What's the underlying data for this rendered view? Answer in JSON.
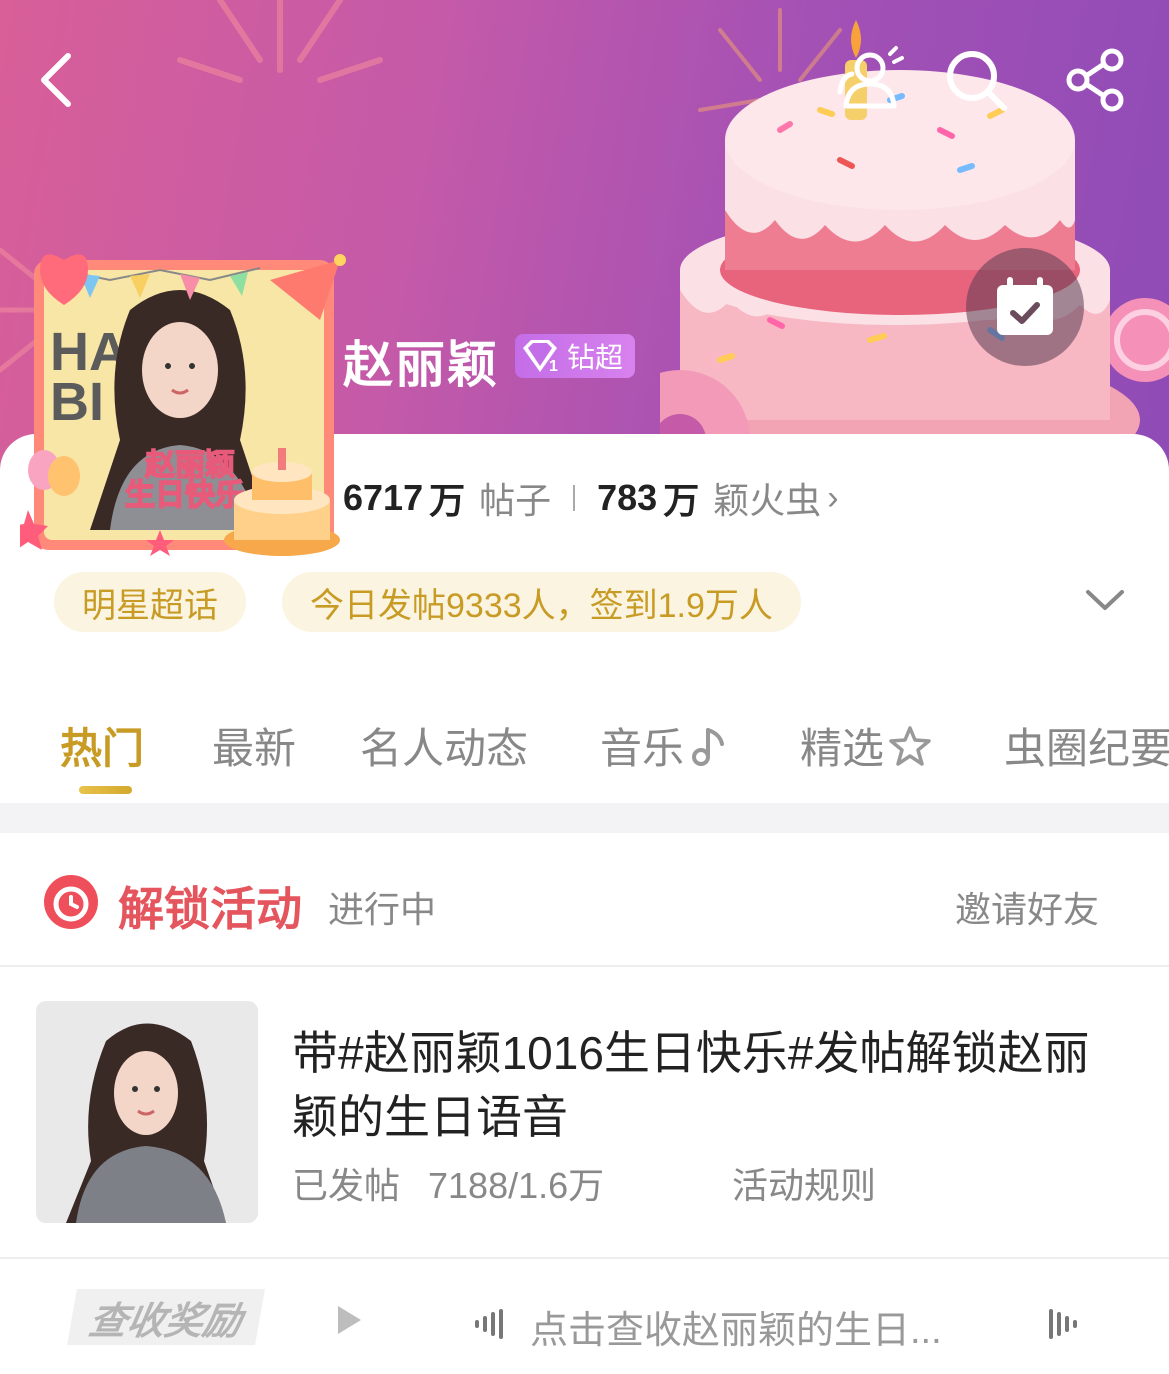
{
  "header": {
    "title": "赵丽颖",
    "badge_label": "钻超",
    "badge_level": "1",
    "avatar_text": "赵丽颖\n生日快乐",
    "avatar_line1": "赵丽颖",
    "avatar_line2": "生日快乐",
    "avatar_bg_text1": "HA",
    "avatar_bg_text2": "BI"
  },
  "stats": {
    "posts_value": "6717",
    "posts_unit": "万",
    "posts_label": "帖子",
    "fans_value": "783",
    "fans_unit": "万",
    "fans_label": "颖火虫"
  },
  "pills": {
    "category": "明星超话",
    "today": "今日发帖9333人，签到1.9万人"
  },
  "tabs": [
    {
      "label": "热门"
    },
    {
      "label": "最新"
    },
    {
      "label": "名人动态"
    },
    {
      "label": "音乐"
    },
    {
      "label": "精选"
    },
    {
      "label": "虫圈纪要"
    }
  ],
  "activity": {
    "title": "解锁活动",
    "status": "进行中",
    "invite": "邀请好友",
    "description": "带#赵丽颖1016生日快乐#发帖解锁赵丽颖的生日语音",
    "progress_label": "已发帖",
    "progress_value": "7188/1.6万",
    "rules": "活动规则"
  },
  "bottom": {
    "reward_label": "查收奖励",
    "voice_text": "点击查收赵丽颖的生日..."
  },
  "colors": {
    "accent_gold": "#c89b24",
    "activity_red": "#e4555d",
    "banner_pink": "#d85f98",
    "banner_purple": "#8f4bb6"
  }
}
